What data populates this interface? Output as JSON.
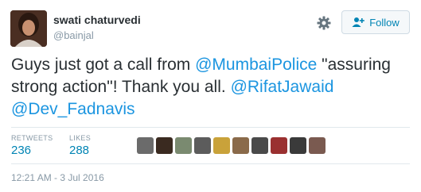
{
  "user": {
    "display_name": "swati chaturvedi",
    "screen_name": "@bainjal"
  },
  "actions": {
    "follow_label": "Follow",
    "settings_icon": "gear-icon",
    "follow_icon": "add-user-icon"
  },
  "tweet": {
    "parts": [
      {
        "text": "Guys just got a call from ",
        "type": "text"
      },
      {
        "text": "@MumbaiPolice",
        "type": "mention"
      },
      {
        "text": " \"assuring strong action\"! Thank you all. ",
        "type": "text"
      },
      {
        "text": "@RifatJawaid",
        "type": "mention"
      },
      {
        "text": " ",
        "type": "text"
      },
      {
        "text": "@Dev_Fadnavis",
        "type": "mention"
      }
    ]
  },
  "stats": {
    "retweets_label": "RETWEETS",
    "retweets_value": "236",
    "likes_label": "LIKES",
    "likes_value": "288"
  },
  "likers": {
    "count": 10,
    "colors": [
      "#6b6b6b",
      "#3a2a20",
      "#7a8a70",
      "#5c5c5c",
      "#c9a23a",
      "#8a6a4a",
      "#4a4a4a",
      "#9a3030",
      "#3a3a3a",
      "#7a5a50"
    ]
  },
  "timestamp": "12:21 AM - 3 Jul 2016",
  "colors": {
    "link": "#1b95e0",
    "accent": "#0084b4",
    "muted": "#8899a6"
  }
}
